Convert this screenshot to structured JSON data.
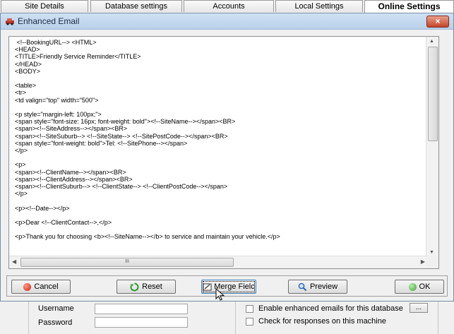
{
  "tabs": [
    "Site Details",
    "Database settings",
    "Accounts",
    "Local Settings",
    "Online Settings"
  ],
  "dialog": {
    "title": "Enhanced Email",
    "close_label": "×",
    "code_lines": [
      " <!--BookingURL--> <HTML>",
      "<HEAD>",
      "<TITLE>Friendly Service Reminder</TITLE>",
      "</HEAD>",
      "<BODY>",
      "",
      "<table>",
      "<tr>",
      "<td valign=\"top\" width=\"500\">",
      "",
      "<p style=\"margin-left: 100px;\">",
      "<span style=\"font-size: 16px; font-weight: bold\"><!--SiteName--></span><BR>",
      "<span><!--SiteAddress--></span><BR>",
      "<span><!--SiteSuburb--> <!--SiteState--> <!--SitePostCode--></span><BR>",
      "<span style=\"font-weight: bold\">Tel: <!--SitePhone--></span>",
      "</p>",
      "",
      "<p>",
      "<span><!--ClientName--></span><BR>",
      "<span><!--ClientAddress--></span><BR>",
      "<span><!--ClientSuburb--> <!--ClientState--> <!--ClientPostCode--></span>",
      "</p>",
      "",
      "<p><!--Date--></p>",
      "",
      "<p>Dear <!--ClientContact-->,</p>",
      "",
      "<p>Thank you for choosing <b><!--SiteName--></b> to service and maintain your vehicle.</p>"
    ],
    "hscroll_grip": "III",
    "buttons": {
      "cancel": "Cancel",
      "reset": "Reset",
      "merge": "Merge Fielc",
      "preview": "Preview",
      "ok": "OK"
    }
  },
  "background_form": {
    "username_label": "Username",
    "password_label": "Password",
    "enable_label": "Enable enhanced emails for this database",
    "check_label": "Check for responses on this machine",
    "ellipsis_label": "..."
  }
}
